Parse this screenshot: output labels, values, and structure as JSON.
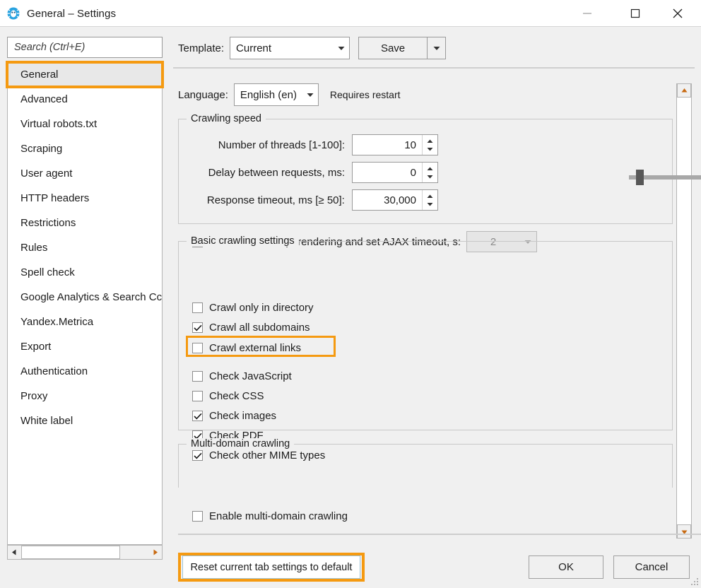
{
  "window": {
    "title": "General – Settings",
    "icon": "spider-icon",
    "minimize_label": "minimize-icon",
    "maximize_label": "maximize-icon",
    "close_label": "close-icon",
    "accent_highlight": "#f59a11"
  },
  "sidebar": {
    "search": {
      "placeholder": "Search (Ctrl+E)",
      "value": ""
    },
    "selected": "General",
    "items": [
      {
        "label": "General"
      },
      {
        "label": "Advanced"
      },
      {
        "label": "Virtual robots.txt"
      },
      {
        "label": "Scraping"
      },
      {
        "label": "User agent"
      },
      {
        "label": "HTTP headers"
      },
      {
        "label": "Restrictions"
      },
      {
        "label": "Rules"
      },
      {
        "label": "Spell check"
      },
      {
        "label": "Google Analytics & Search Cc"
      },
      {
        "label": "Yandex.Metrica"
      },
      {
        "label": "Export"
      },
      {
        "label": "Authentication"
      },
      {
        "label": "Proxy"
      },
      {
        "label": "White label"
      }
    ],
    "hscroll": {
      "left_icon": "triangle-left-icon",
      "right_icon": "triangle-right-icon"
    }
  },
  "toolbar": {
    "template_label": "Template:",
    "template_value": "Current",
    "save_label": "Save",
    "save_arrow_icon": "chevron-down-icon"
  },
  "language": {
    "label": "Language:",
    "value": "English (en)",
    "note": "Requires restart"
  },
  "crawling_speed": {
    "legend": "Crawling speed",
    "fields": [
      {
        "label": "Number of threads [1-100]:",
        "value": "10"
      },
      {
        "label": "Delay between requests, ms:",
        "value": "0"
      },
      {
        "label": "Response timeout, ms [≥ 50]:",
        "value": "30,000"
      }
    ],
    "slider": {
      "min": 1,
      "max": 100,
      "value": 10
    },
    "javascript": {
      "label": "Enable JavaScript rendering and set AJAX timeout, s:",
      "checked": false,
      "timeout_value": "2",
      "timeout_disabled": true
    }
  },
  "basic_crawling": {
    "legend": "Basic crawling settings",
    "group_one": [
      {
        "label": "Crawl only in directory",
        "checked": false
      },
      {
        "label": "Crawl all subdomains",
        "checked": true,
        "highlighted": true
      },
      {
        "label": "Crawl external links",
        "checked": false
      }
    ],
    "group_two": [
      {
        "label": "Check JavaScript",
        "checked": false
      },
      {
        "label": "Check CSS",
        "checked": false
      },
      {
        "label": "Check images",
        "checked": true
      },
      {
        "label": "Check PDF",
        "checked": true
      },
      {
        "label": "Check other MIME types",
        "checked": true
      }
    ]
  },
  "multi_domain": {
    "legend": "Multi-domain crawling",
    "checkbox": {
      "label": "Enable multi-domain crawling",
      "checked": false
    }
  },
  "footer": {
    "reset_label": "Reset current tab settings to default",
    "ok_label": "OK",
    "cancel_label": "Cancel"
  },
  "scrollbar": {
    "up_icon": "triangle-up-icon",
    "down_icon": "triangle-down-icon"
  }
}
